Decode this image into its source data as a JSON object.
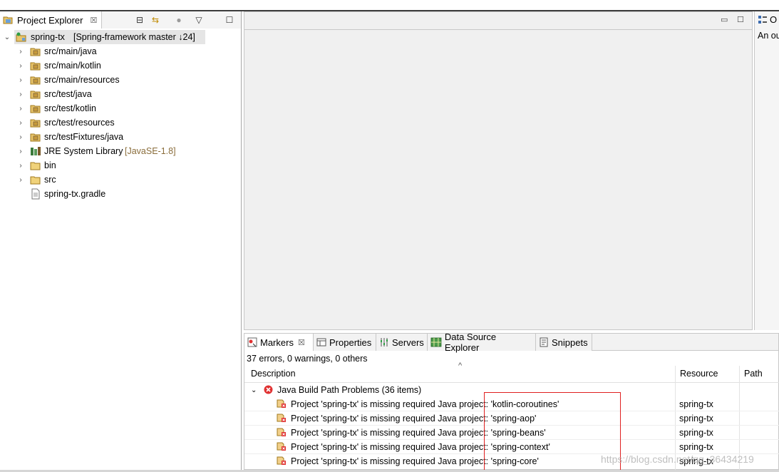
{
  "explorer": {
    "title": "Project Explorer",
    "close": "☒",
    "toolbar": [
      "⊟",
      "⇆",
      "●",
      "▽",
      "☐"
    ],
    "root": {
      "label": "spring-tx",
      "decoration": "[Spring-framework master ↓24]"
    },
    "items": [
      {
        "label": "src/main/java",
        "suffix": "",
        "expandable": true,
        "icon": "package-folder-icon"
      },
      {
        "label": "src/main/kotlin",
        "suffix": "",
        "expandable": true,
        "icon": "package-folder-icon"
      },
      {
        "label": "src/main/resources",
        "suffix": "",
        "expandable": true,
        "icon": "package-folder-icon"
      },
      {
        "label": "src/test/java",
        "suffix": "",
        "expandable": true,
        "icon": "package-folder-icon"
      },
      {
        "label": "src/test/kotlin",
        "suffix": "",
        "expandable": true,
        "icon": "package-folder-icon"
      },
      {
        "label": "src/test/resources",
        "suffix": "",
        "expandable": true,
        "icon": "package-folder-icon"
      },
      {
        "label": "src/testFixtures/java",
        "suffix": "",
        "expandable": true,
        "icon": "package-folder-icon"
      },
      {
        "label": "JRE System Library",
        "suffix": "[JavaSE-1.8]",
        "expandable": true,
        "icon": "library-icon"
      },
      {
        "label": "bin",
        "suffix": "",
        "expandable": true,
        "icon": "folder-icon"
      },
      {
        "label": "src",
        "suffix": "",
        "expandable": true,
        "icon": "folder-icon"
      },
      {
        "label": "spring-tx.gradle",
        "suffix": "",
        "expandable": false,
        "icon": "file-icon"
      }
    ]
  },
  "editor": {
    "minimize": "▭",
    "maximize": "☐"
  },
  "outline": {
    "title": "O",
    "message": "An ou"
  },
  "panel": {
    "tabs": [
      {
        "label": "Markers",
        "close": "☒"
      },
      {
        "label": "Properties"
      },
      {
        "label": "Servers"
      },
      {
        "label": "Data Source Explorer"
      },
      {
        "label": "Snippets"
      }
    ],
    "summary": "37 errors, 0 warnings, 0 others",
    "sort_indicator": "^",
    "columns": [
      "Description",
      "Resource",
      "Path"
    ],
    "group": {
      "label": "Java Build Path Problems (36 items)"
    },
    "rows": [
      {
        "description": "Project 'spring-tx' is missing required Java project: 'kotlin-coroutines'",
        "resource": "spring-tx",
        "path": ""
      },
      {
        "description": "Project 'spring-tx' is missing required Java project: 'spring-aop'",
        "resource": "spring-tx",
        "path": ""
      },
      {
        "description": "Project 'spring-tx' is missing required Java project: 'spring-beans'",
        "resource": "spring-tx",
        "path": ""
      },
      {
        "description": "Project 'spring-tx' is missing required Java project: 'spring-context'",
        "resource": "spring-tx",
        "path": ""
      },
      {
        "description": "Project 'spring-tx' is missing required Java project: 'spring-core'",
        "resource": "spring-tx",
        "path": ""
      }
    ],
    "watermark": "https://blog.csdn.net/qq_36434219"
  },
  "colors": {
    "error": "#e03131",
    "highlight": "#e02020",
    "decoration": "#8a6d3b"
  }
}
